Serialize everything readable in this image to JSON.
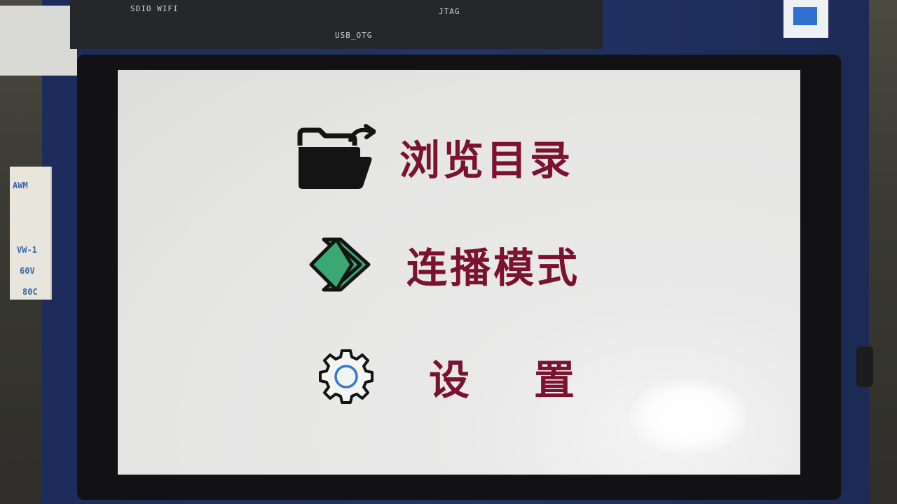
{
  "board": {
    "silk_sdio": "SDIO  WIFI",
    "silk_usb": "USB_OTG",
    "silk_jtag": "JTAG",
    "ribbon_awm": "AWM",
    "ribbon_vw": "VW-1",
    "ribbon_60v": "60V",
    "ribbon_80c": "80C"
  },
  "menu": {
    "items": [
      {
        "label": "浏览目录",
        "icon": "folder-icon"
      },
      {
        "label": "连播模式",
        "icon": "carousel-icon"
      },
      {
        "label": "设置",
        "icon": "gear-icon"
      }
    ]
  },
  "colors": {
    "label": "#7a1230",
    "screen_background": "#e6e6e5",
    "carousel_icon": "#3aa873",
    "gear_inner_ring": "#2f7bd6"
  }
}
